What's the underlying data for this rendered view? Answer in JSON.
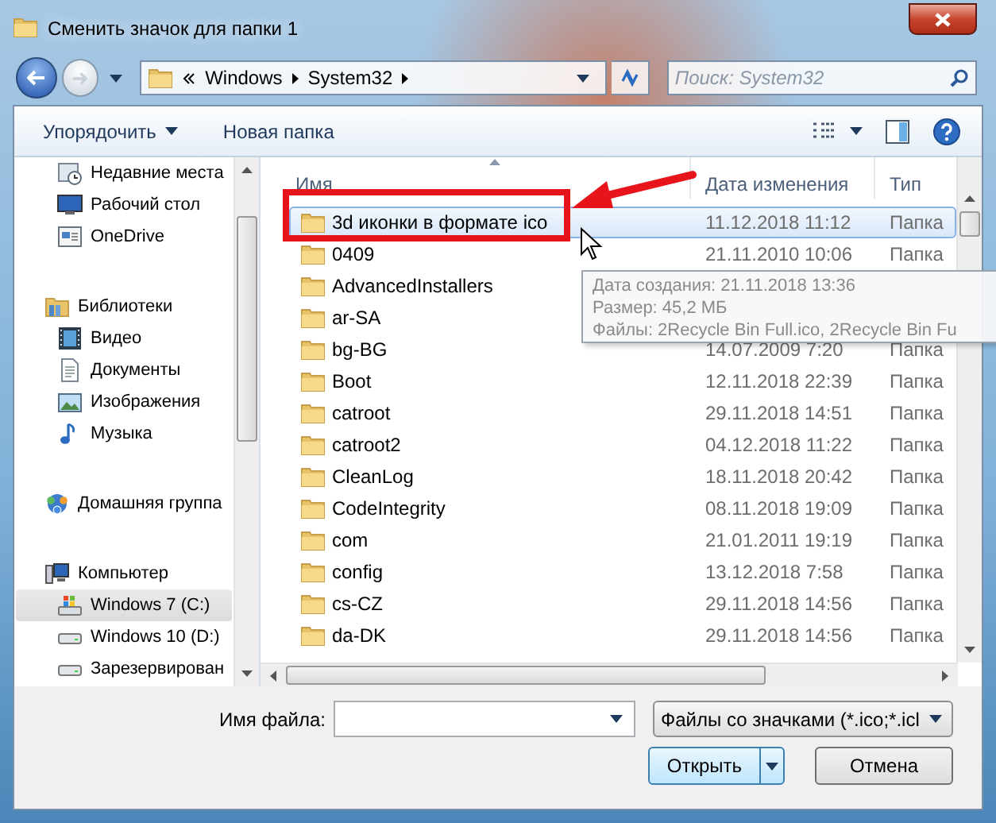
{
  "window": {
    "title": "Сменить значок для папки 1"
  },
  "address": {
    "crumbs": [
      "Windows",
      "System32"
    ]
  },
  "search": {
    "placeholder": "Поиск: System32"
  },
  "toolbar": {
    "organize": "Упорядочить",
    "new_folder": "Новая папка"
  },
  "sidebar": {
    "sections": [
      {
        "items": [
          {
            "label": "Недавние места",
            "kind": "recent",
            "selected": false
          },
          {
            "label": "Рабочий стол",
            "kind": "desktop",
            "selected": false
          },
          {
            "label": "OneDrive",
            "kind": "cloud",
            "selected": false
          }
        ]
      },
      {
        "label": "Библиотеки",
        "kind": "library",
        "children": [
          {
            "label": "Видео",
            "kind": "video",
            "selected": false
          },
          {
            "label": "Документы",
            "kind": "documents",
            "selected": false
          },
          {
            "label": "Изображения",
            "kind": "pictures",
            "selected": false
          },
          {
            "label": "Музыка",
            "kind": "music",
            "selected": false
          }
        ]
      },
      {
        "label": "Домашняя группа",
        "kind": "homegroup"
      },
      {
        "label": "Компьютер",
        "kind": "computer",
        "children": [
          {
            "label": "Windows 7 (C:)",
            "kind": "system-drive",
            "selected": true
          },
          {
            "label": "Windows 10 (D:)",
            "kind": "drive",
            "selected": false
          },
          {
            "label": "Зарезервирован",
            "kind": "drive",
            "selected": false
          }
        ]
      }
    ]
  },
  "table": {
    "columns": [
      "Имя",
      "Дата изменения",
      "Тип"
    ],
    "rows": [
      {
        "name": "3d иконки в формате ico",
        "date": "11.12.2018 11:12",
        "type": "Папка",
        "selected": true
      },
      {
        "name": "0409",
        "date": "21.11.2010 10:06",
        "type": "Папка",
        "selected": false
      },
      {
        "name": "AdvancedInstallers",
        "selected": false
      },
      {
        "name": "ar-SA",
        "selected": false
      },
      {
        "name": "bg-BG",
        "date": "14.07.2009 7:20",
        "type": "Папка",
        "selected": false
      },
      {
        "name": "Boot",
        "date": "12.11.2018 22:39",
        "type": "Папка",
        "selected": false
      },
      {
        "name": "catroot",
        "date": "29.11.2018 14:51",
        "type": "Папка",
        "selected": false
      },
      {
        "name": "catroot2",
        "date": "04.12.2018 11:22",
        "type": "Папка",
        "selected": false
      },
      {
        "name": "CleanLog",
        "date": "18.11.2018 20:42",
        "type": "Папка",
        "selected": false
      },
      {
        "name": "CodeIntegrity",
        "date": "08.11.2018 19:09",
        "type": "Папка",
        "selected": false
      },
      {
        "name": "com",
        "date": "21.01.2011 19:19",
        "type": "Папка",
        "selected": false
      },
      {
        "name": "config",
        "date": "13.12.2018 7:58",
        "type": "Папка",
        "selected": false
      },
      {
        "name": "cs-CZ",
        "date": "29.11.2018 14:56",
        "type": "Папка",
        "selected": false
      },
      {
        "name": "da-DK",
        "date": "29.11.2018 14:56",
        "type": "Папка",
        "selected": false
      }
    ]
  },
  "tooltip": {
    "lines": [
      "Дата создания: 21.11.2018 13:36",
      "Размер: 45,2 МБ",
      "Файлы: 2Recycle Bin Full.ico, 2Recycle Bin Fu"
    ]
  },
  "file_name": {
    "label": "Имя файла:"
  },
  "file_type": {
    "value": "Файлы со значками (*.ico;*.icl"
  },
  "buttons": {
    "open": "Открыть",
    "cancel": "Отмена"
  }
}
